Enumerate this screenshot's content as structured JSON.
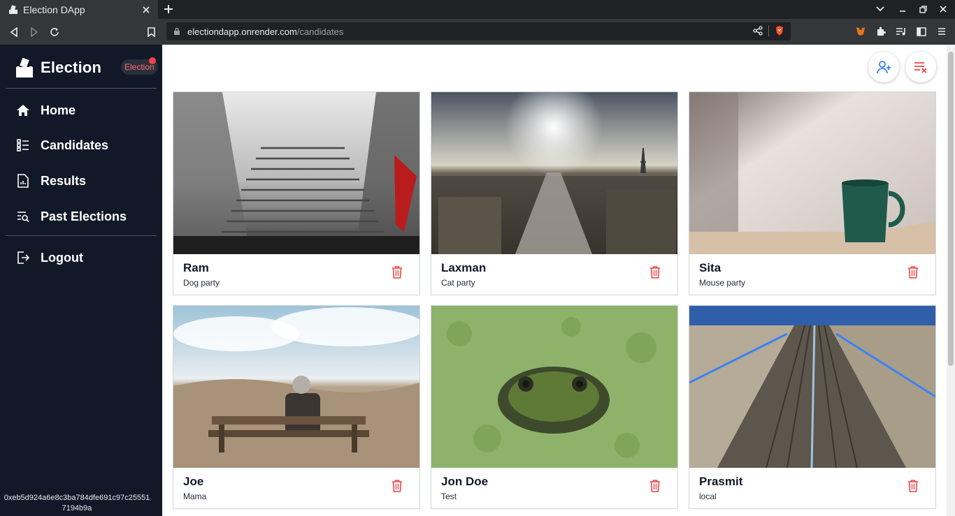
{
  "browser": {
    "tab_title": "Election DApp",
    "url_host": "electiondapp.onrender.com",
    "url_path": "/candidates"
  },
  "sidebar": {
    "brand_title": "Election",
    "brand_badge": "Election",
    "items": [
      {
        "label": "Home",
        "icon": "home-icon"
      },
      {
        "label": "Candidates",
        "icon": "list-icon"
      },
      {
        "label": "Results",
        "icon": "document-chart-icon"
      },
      {
        "label": "Past Elections",
        "icon": "search-list-icon"
      }
    ],
    "logout_label": "Logout",
    "wallet_address": "0xeb5d924a6e8c3ba784dfe691c97c255517194b9a"
  },
  "actions": {
    "add_icon": "add-user-icon",
    "clear_icon": "clear-list-icon"
  },
  "candidates": [
    {
      "name": "Ram",
      "party": "Dog party",
      "photo": "foggy-stairs"
    },
    {
      "name": "Laxman",
      "party": "Cat party",
      "photo": "paris-skyline"
    },
    {
      "name": "Sita",
      "party": "Mouse party",
      "photo": "green-mug-bed"
    },
    {
      "name": "Joe",
      "party": "Mama",
      "photo": "person-on-bench"
    },
    {
      "name": "Jon Doe",
      "party": "Test",
      "photo": "frog-in-pond"
    },
    {
      "name": "Prasmit",
      "party": "local",
      "photo": "railway-tracks"
    }
  ],
  "colors": {
    "sidebar_bg": "#111827",
    "accent_red": "#ef4444",
    "fab_blue": "#3b82f6"
  }
}
